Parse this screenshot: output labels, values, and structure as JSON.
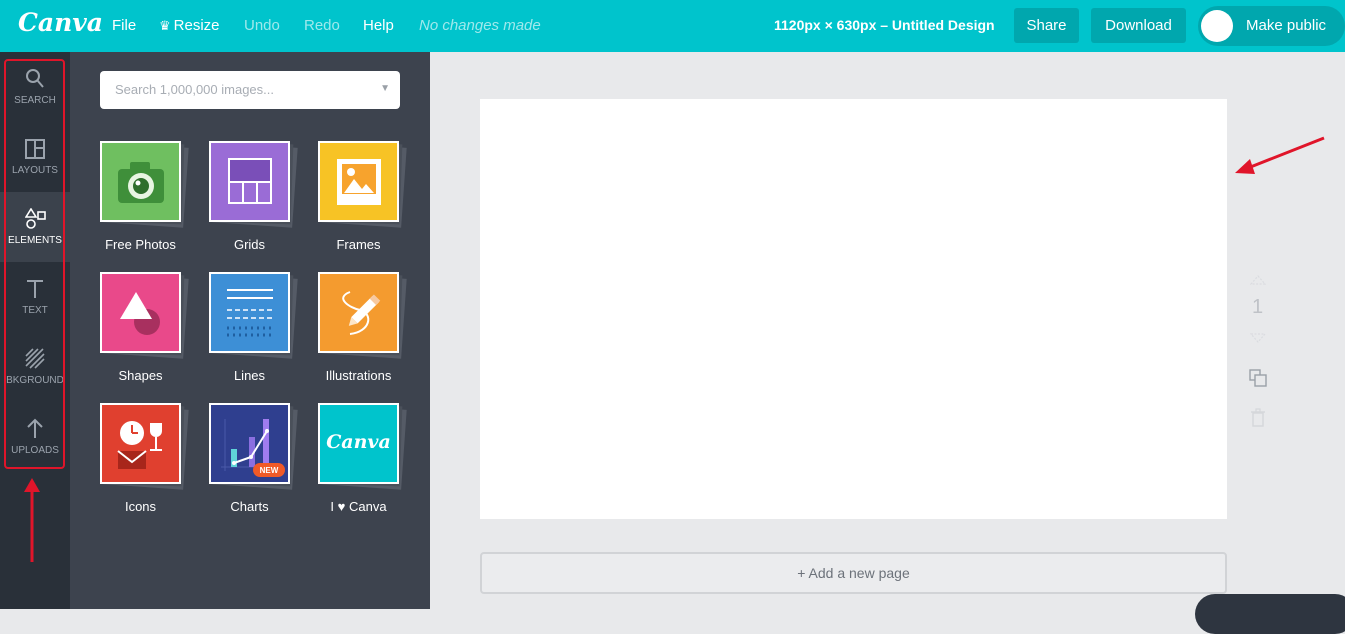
{
  "app": {
    "logo": "Canva"
  },
  "menu": {
    "file": "File",
    "resize": "Resize",
    "undo": "Undo",
    "redo": "Redo",
    "help": "Help",
    "status": "No changes made"
  },
  "design": {
    "title": "1120px × 630px – Untitled Design"
  },
  "actions": {
    "share": "Share",
    "download": "Download",
    "make_public": "Make public"
  },
  "sidebar": {
    "items": [
      {
        "label": "SEARCH",
        "icon": "search-icon"
      },
      {
        "label": "LAYOUTS",
        "icon": "layouts-icon"
      },
      {
        "label": "ELEMENTS",
        "icon": "elements-icon",
        "active": true
      },
      {
        "label": "TEXT",
        "icon": "text-icon"
      },
      {
        "label": "BKGROUND",
        "icon": "background-icon"
      },
      {
        "label": "UPLOADS",
        "icon": "uploads-icon"
      }
    ]
  },
  "panel": {
    "search_placeholder": "Search 1,000,000 images...",
    "tiles": [
      {
        "label": "Free Photos",
        "color": "#6fbf60"
      },
      {
        "label": "Grids",
        "color": "#9a6cd6"
      },
      {
        "label": "Frames",
        "color": "#f7c325"
      },
      {
        "label": "Shapes",
        "color": "#e9498a"
      },
      {
        "label": "Lines",
        "color": "#3d8fd6"
      },
      {
        "label": "Illustrations",
        "color": "#f49b2f"
      },
      {
        "label": "Icons",
        "color": "#e0402f"
      },
      {
        "label": "Charts",
        "color": "#2f3f8f",
        "badge": "NEW"
      },
      {
        "label": "I ♥ Canva",
        "color": "#00c4cc",
        "logo_text": "Canva"
      }
    ]
  },
  "canvas": {
    "page_number": "1",
    "add_page": "+ Add a new page"
  },
  "colors": {
    "brand": "#00c4cc",
    "sidebar": "#293039",
    "panel": "#3d434e",
    "annotation": "#e0152a"
  }
}
